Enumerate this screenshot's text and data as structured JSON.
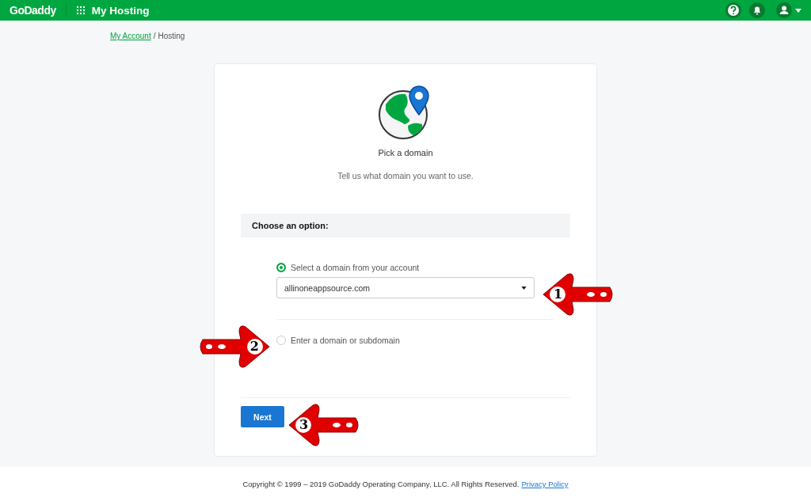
{
  "header": {
    "logo": "GoDaddy",
    "title": "My Hosting"
  },
  "breadcrumb": {
    "link": "My Account",
    "separator": "/",
    "current": "Hosting"
  },
  "card": {
    "title": "Pick a domain",
    "subtitle": "Tell us what domain you want to use.",
    "option_header": "Choose an option:",
    "options": [
      {
        "label": "Select a domain from your account",
        "selected": true,
        "kind": "dropdown",
        "value": "allinoneappsource.com"
      },
      {
        "label": "Enter a domain or subdomain",
        "selected": false,
        "kind": "plain"
      }
    ],
    "button": "Next"
  },
  "callouts": [
    {
      "number": "1",
      "kind": "left"
    },
    {
      "number": "2",
      "kind": "right"
    },
    {
      "number": "3",
      "kind": "left"
    }
  ],
  "footer": {
    "text": "Copyright © 1999 – 2019 GoDaddy Operating Company, LLC. All Rights Reserved.",
    "link": "Privacy Policy"
  }
}
